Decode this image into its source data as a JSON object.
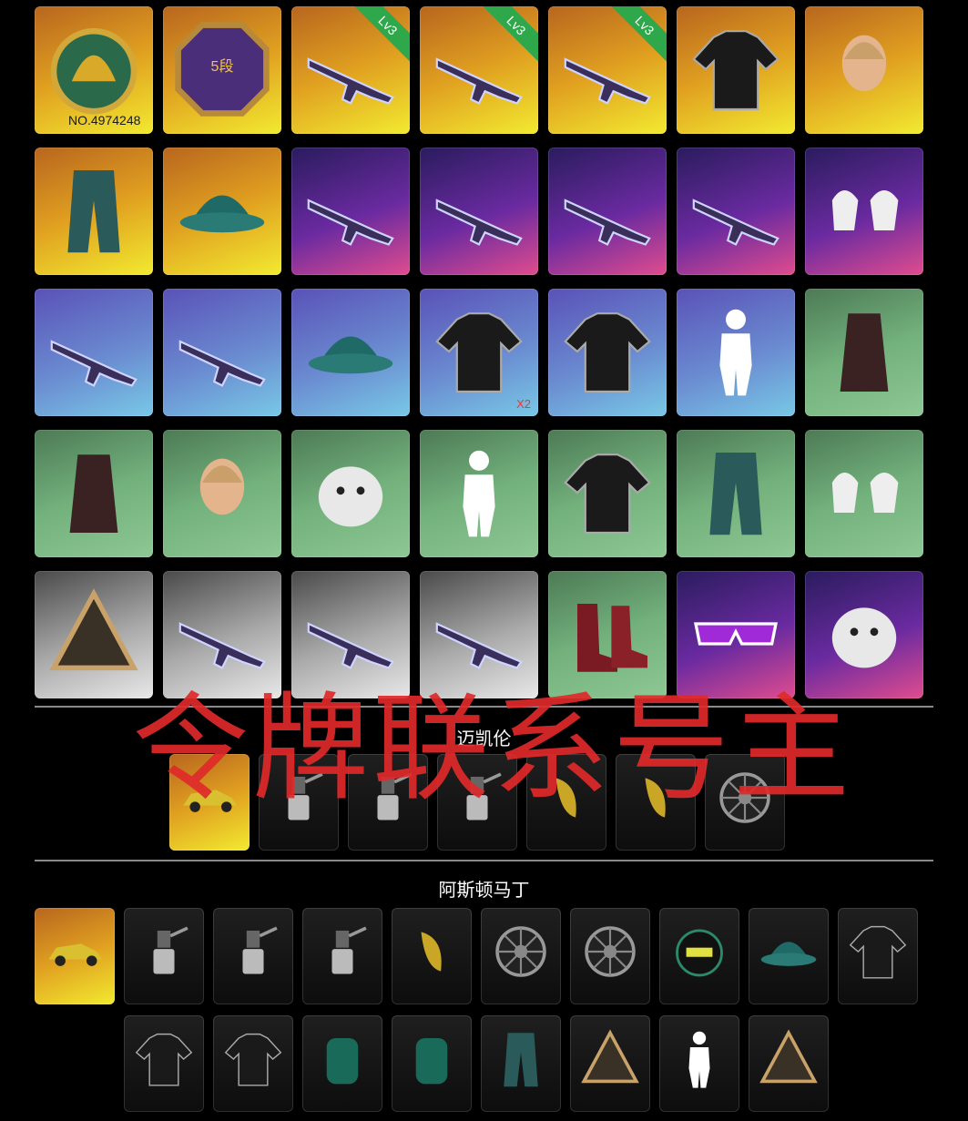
{
  "grid_items": [
    {
      "name": "pubg-helmet-badge",
      "bg": "gold",
      "num": "NO.4974248"
    },
    {
      "name": "rank-badge",
      "bg": "gold",
      "rank": "5段"
    },
    {
      "name": "weapon-skin-1",
      "bg": "gold",
      "lv": "Lv3"
    },
    {
      "name": "weapon-skin-2",
      "bg": "gold",
      "lv": "Lv3"
    },
    {
      "name": "weapon-skin-3",
      "bg": "gold",
      "lv": "Lv3"
    },
    {
      "name": "red-jacket",
      "bg": "gold"
    },
    {
      "name": "character-head",
      "bg": "gold"
    },
    {
      "name": "white-skirt",
      "bg": "gold"
    },
    {
      "name": "bucket-hat",
      "bg": "gold"
    },
    {
      "name": "rifle-skin-blue",
      "bg": "purple"
    },
    {
      "name": "rifle-skin-green",
      "bg": "purple"
    },
    {
      "name": "rifle-skin-cyan",
      "bg": "purple"
    },
    {
      "name": "rifle-skin-gold",
      "bg": "purple"
    },
    {
      "name": "wrapped-gloves",
      "bg": "purple"
    },
    {
      "name": "rifle-skin-orange",
      "bg": "blue"
    },
    {
      "name": "sniper-skin-purple",
      "bg": "blue"
    },
    {
      "name": "teal-bucket-hat",
      "bg": "blue"
    },
    {
      "name": "black-tshirt",
      "bg": "blue",
      "qty": "X2"
    },
    {
      "name": "purple-jacket",
      "bg": "blue"
    },
    {
      "name": "emote-pose",
      "bg": "blue"
    },
    {
      "name": "red-bandana",
      "bg": "green"
    },
    {
      "name": "hooded-coat",
      "bg": "green"
    },
    {
      "name": "female-face",
      "bg": "green"
    },
    {
      "name": "polar-bear-mask",
      "bg": "green"
    },
    {
      "name": "white-suit",
      "bg": "green"
    },
    {
      "name": "pjs-jacket",
      "bg": "green"
    },
    {
      "name": "teal-pants",
      "bg": "green"
    },
    {
      "name": "paw-gloves",
      "bg": "green"
    },
    {
      "name": "triangle-emblem",
      "bg": "silver"
    },
    {
      "name": "rifle-skin-black",
      "bg": "silver"
    },
    {
      "name": "smg-skin-blue",
      "bg": "silver"
    },
    {
      "name": "rifle-skin-tan",
      "bg": "silver"
    },
    {
      "name": "red-boots",
      "bg": "green"
    },
    {
      "name": "purple-sunglasses",
      "bg": "purple"
    },
    {
      "name": "gold-skull-mask",
      "bg": "purple"
    }
  ],
  "mclaren": {
    "title": "迈凯伦",
    "items": [
      {
        "name": "yellow-car",
        "bg": "gold"
      },
      {
        "name": "paint-gray",
        "bg": "dark"
      },
      {
        "name": "paint-orange",
        "bg": "dark"
      },
      {
        "name": "paint-yellow",
        "bg": "dark"
      },
      {
        "name": "yellow-part",
        "bg": "dark"
      },
      {
        "name": "red-part",
        "bg": "dark"
      },
      {
        "name": "wheel-rim",
        "bg": "dark"
      }
    ]
  },
  "aston": {
    "title": "阿斯顿马丁",
    "row1": [
      {
        "name": "green-car",
        "bg": "gold"
      },
      {
        "name": "paint-purple",
        "bg": "dark"
      },
      {
        "name": "paint-teal",
        "bg": "dark"
      },
      {
        "name": "paint-white",
        "bg": "dark"
      },
      {
        "name": "black-part",
        "bg": "dark"
      },
      {
        "name": "wheel-dark",
        "bg": "dark"
      },
      {
        "name": "wheel-silver",
        "bg": "dark"
      },
      {
        "name": "racing-helmet",
        "bg": "dark"
      },
      {
        "name": "black-cap",
        "bg": "dark"
      },
      {
        "name": "teal-jacket",
        "bg": "dark"
      }
    ],
    "row2": [
      {
        "name": "teal-vest",
        "bg": "dark"
      },
      {
        "name": "teal-polo",
        "bg": "dark"
      },
      {
        "name": "black-backpack",
        "bg": "dark"
      },
      {
        "name": "green-backpack",
        "bg": "dark"
      },
      {
        "name": "white-pants",
        "bg": "dark"
      },
      {
        "name": "aston-logo",
        "bg": "dark"
      },
      {
        "name": "salute-emote",
        "bg": "dark"
      },
      {
        "name": "aston-badge",
        "bg": "dark"
      }
    ]
  },
  "watermark": "令牌联系号主",
  "colors": {
    "lv_badge": "#2fa84b",
    "watermark": "#e02a2a",
    "qty": "#e23b3b"
  }
}
